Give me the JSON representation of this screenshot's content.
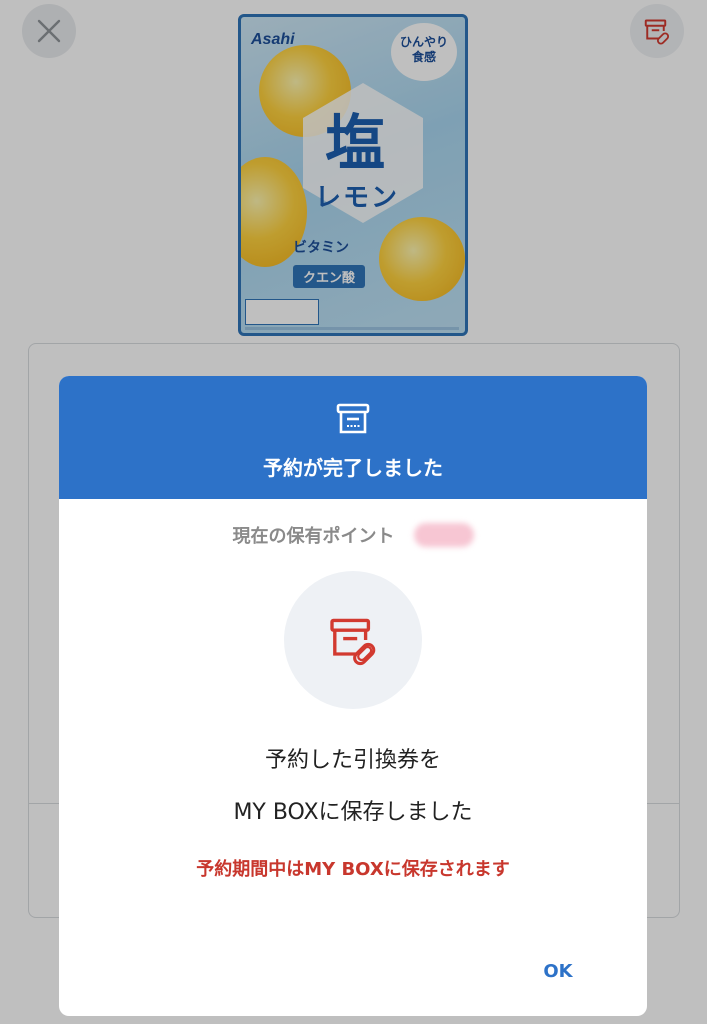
{
  "background": {
    "close_icon": "close-icon",
    "mybox_icon": "mybox-coupon-icon",
    "product": {
      "brand": "Asahi",
      "bubble_line1": "ひんやり",
      "bubble_line2": "食感",
      "name_big": "塩",
      "name_sub": "レモン",
      "vitamin": "ビタミン",
      "citric": "クエン酸"
    }
  },
  "modal": {
    "header_icon": "archive-box-icon",
    "title": "予約が完了しました",
    "points_label": "現在の保有ポイント",
    "points_value": "",
    "center_icon": "coupon-attach-icon",
    "message_line1": "予約した引換券を",
    "message_line2": "MY BOXに保存しました",
    "note": "予約期間中はMY BOXに保存されます",
    "ok_label": "OK"
  },
  "colors": {
    "header_blue": "#2d72c8",
    "accent_red": "#c8372d",
    "ok_blue": "#2d72c8"
  }
}
